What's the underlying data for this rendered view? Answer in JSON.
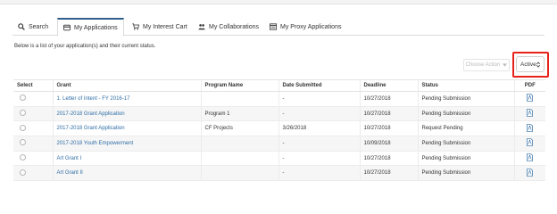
{
  "tabs": [
    {
      "label": "Search",
      "icon": "search-icon"
    },
    {
      "label": "My Applications",
      "icon": "card-icon"
    },
    {
      "label": "My Interest Cart",
      "icon": "cart-icon"
    },
    {
      "label": "My Collaborations",
      "icon": "users-icon"
    },
    {
      "label": "My Proxy Applications",
      "icon": "window-icon"
    }
  ],
  "intro_text": "Below is a list of your application(s) and their current status.",
  "actions": {
    "choose_action_label": "Choose Action",
    "status_filter_value": "Active"
  },
  "table": {
    "headers": [
      "Select",
      "Grant",
      "Program Name",
      "Date Submitted",
      "Deadline",
      "Status",
      "PDF"
    ],
    "rows": [
      {
        "grant": "1. Letter of Intent - FY 2016-17",
        "program": "",
        "date_submitted": "-",
        "deadline": "10/27/2018",
        "status": "Pending Submission"
      },
      {
        "grant": "2017-2018 Grant Application",
        "program": "Program 1",
        "date_submitted": "-",
        "deadline": "10/27/2018",
        "status": "Pending Submission"
      },
      {
        "grant": "2017-2018 Grant Application",
        "program": "CF Projects",
        "date_submitted": "3/26/2018",
        "deadline": "10/27/2018",
        "status": "Request Pending"
      },
      {
        "grant": "2017-2018 Youth Empowerment",
        "program": "",
        "date_submitted": "-",
        "deadline": "10/09/2018",
        "status": "Pending Submission"
      },
      {
        "grant": "Art Grant I",
        "program": "",
        "date_submitted": "-",
        "deadline": "10/27/2018",
        "status": "Pending Submission"
      },
      {
        "grant": "Art Grant II",
        "program": "",
        "date_submitted": "-",
        "deadline": "10/27/2018",
        "status": "Pending Submission"
      }
    ]
  },
  "colors": {
    "link": "#2f6ea6",
    "highlight": "#e8221b",
    "active_tab_border": "#2f5f8f"
  }
}
